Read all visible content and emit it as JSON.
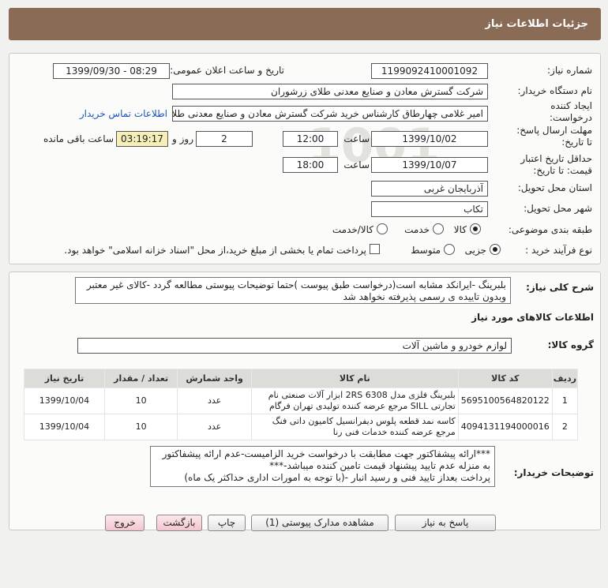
{
  "header": {
    "title": "جزئیات اطلاعات نیاز"
  },
  "form": {
    "need_number_label": "شماره نیاز:",
    "need_number": "1199092410001092",
    "announce_label": "تاریخ و ساعت اعلان عمومی:",
    "announce_value": "1399/09/30 - 08:29",
    "buyer_org_label": "نام دستگاه خریدار:",
    "buyer_org": "شرکت گسترش معادن و صنایع معدنی طلای زرشوران",
    "creator_label": "ایجاد کننده درخواست:",
    "creator": "امیر  غلامی چهارطاق کارشناس خرید شرکت گسترش معادن و صنایع معدنی طلای زرشوران",
    "contact_link": "اطلاعات تماس خریدار",
    "deadline_label": "مهلت ارسال پاسخ: تا تاریخ:",
    "deadline_date": "1399/10/02",
    "time_label": "ساعت",
    "deadline_time": "12:00",
    "days_count": "2",
    "days_label": "روز و",
    "remaining_time": "03:19:17",
    "remaining_label": "ساعت باقی مانده",
    "validity_label": "حداقل تاریخ اعتبار قیمت: تا تاریخ:",
    "validity_date": "1399/10/07",
    "validity_time": "18:00",
    "province_label": "استان محل تحویل:",
    "province": "آذربایجان غربی",
    "city_label": "شهر محل تحویل:",
    "city": "تکاب",
    "category_label": "طبقه بندی موضوعی:",
    "category_options": [
      "کالا",
      "خدمت",
      "کالا/خدمت"
    ],
    "purchase_type_label": "نوع فرآیند خرید :",
    "purchase_options": [
      "جزیی",
      "متوسط"
    ],
    "payment_note": "پرداخت تمام یا بخشی از مبلغ خرید،از محل \"اسناد خزانه اسلامی\" خواهد بود."
  },
  "description": {
    "label": "شرح کلی نیاز:",
    "text": "بلبرینگ -ایرانکد مشابه است(درخواست طبق پیوست )حتما توضیحات پیوستی مطالعه گردد -کالای غیر معتبر وبدون تاییده ی رسمی پذیرفته نخواهد شد"
  },
  "goods_info": {
    "title": "اطلاعات کالاهای مورد نیاز",
    "group_label": "گروه کالا:",
    "group_value": "لوازم خودرو و ماشین آلات"
  },
  "table": {
    "headers": [
      "ردیف",
      "کد کالا",
      "نام کالا",
      "واحد شمارش",
      "تعداد / مقدار",
      "تاریخ نیاز"
    ],
    "rows": [
      {
        "row": "1",
        "code": "5695100564820122",
        "name": "بلبرینگ فلزی مدل 2RS 6308 ابزار آلات صنعتی نام تجارتی SILL مرجع عرضه کننده تولیدی تهران فرگام",
        "unit": "عدد",
        "qty": "10",
        "date": "1399/10/04"
      },
      {
        "row": "2",
        "code": "4094131194000016",
        "name": "کاسه نمد قطعه پلوس دیفرانسیل کامیون داتی فنگ مرجع عرضه کننده خدمات فنی رنا",
        "unit": "عدد",
        "qty": "10",
        "date": "1399/10/04"
      }
    ]
  },
  "buyer_notes": {
    "label": "توضیحات خریدار:",
    "lines": [
      "***ارائه پیشفاکتور جهت مطابقت با درخواست خرید الزامیست-عدم ارائه پیشفاکتور به منزله عدم تایید پیشنهاد قیمت تامین کننده میباشد-***",
      "پرداخت بعداز تایید فنی و رسید انبار -(با توجه به امورات اداری حداکثر یک ماه)"
    ]
  },
  "buttons": {
    "reply": "پاسخ به نیاز",
    "attachments": "مشاهده مدارک پیوستی (1)",
    "print": "چاپ",
    "back": "بازگشت",
    "exit": "خروج"
  }
}
